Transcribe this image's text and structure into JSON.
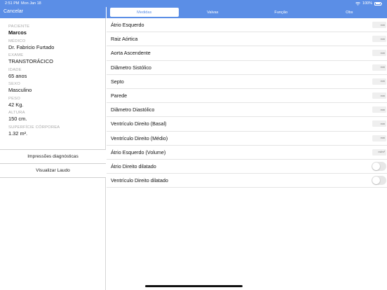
{
  "status_bar": {
    "time": "2:51 PM",
    "date": "Mon Jan 18",
    "battery_text": "100%",
    "color": "#5b8ee6"
  },
  "left": {
    "cancel_label": "Cancelar",
    "fields": [
      {
        "label": "PACIENTE",
        "value": "Marcos",
        "bold": true
      },
      {
        "label": "MÉDICO",
        "value": "Dr. Fabricio Furtado"
      },
      {
        "label": "EXAME",
        "value": "TRANSTORÁCICO"
      },
      {
        "label": "IDADE",
        "value": "65 anos"
      },
      {
        "label": "SEXO",
        "value": "Masculino"
      },
      {
        "label": "PESO",
        "value": "42 Kg."
      },
      {
        "label": "ALTURA",
        "value": "150 cm."
      },
      {
        "label": "SUPERFÍCIE CÓRPOREA",
        "value": "1.32 m²."
      }
    ],
    "buttons": {
      "impressions": "Impressões diagnósticas",
      "report": "Visualizar Laudo"
    }
  },
  "tabs": [
    {
      "label": "Medidas",
      "active": true
    },
    {
      "label": "Valvas"
    },
    {
      "label": "Função"
    },
    {
      "label": "Obs"
    }
  ],
  "rows": [
    {
      "label": "Átrio Esquerdo",
      "type": "field",
      "placeholder": "mm"
    },
    {
      "label": "Raiz Aórtica",
      "type": "field",
      "placeholder": "mm"
    },
    {
      "label": "Aorta Ascendente",
      "type": "field",
      "placeholder": "mm"
    },
    {
      "label": "Diâmetro Sistólico",
      "type": "field",
      "placeholder": "mm"
    },
    {
      "label": "Septo",
      "type": "field",
      "placeholder": "mm"
    },
    {
      "label": "Parede",
      "type": "field",
      "placeholder": "mm"
    },
    {
      "label": "Diâmetro Diastólico",
      "type": "field",
      "placeholder": "mm"
    },
    {
      "label": "Ventrículo Direito (Basal)",
      "type": "field",
      "placeholder": "mm"
    },
    {
      "label": "Ventrículo Direito (Médio)",
      "type": "field",
      "placeholder": "mm"
    },
    {
      "label": "Átrio Esquerdo (Volume)",
      "type": "field",
      "placeholder": "ml/m²"
    },
    {
      "label": "Átrio Direito dilatado",
      "type": "toggle",
      "on": false
    },
    {
      "label": "Ventrículo Direito dilatado",
      "type": "toggle",
      "on": false
    }
  ]
}
